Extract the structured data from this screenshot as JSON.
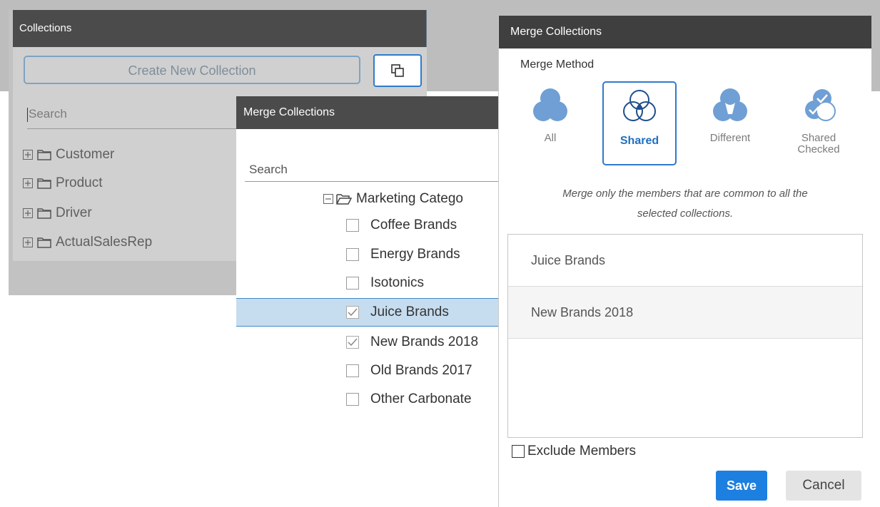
{
  "collections_panel": {
    "title": "Collections",
    "create_button_label": "Create New Collection",
    "search_placeholder": "Search",
    "tree_items": [
      {
        "label": "Customer"
      },
      {
        "label": "Product"
      },
      {
        "label": "Driver"
      },
      {
        "label": "ActualSalesRep"
      }
    ],
    "icons": {
      "expand": "plus-square-icon",
      "folder": "folder-icon",
      "collapse_panel": "collapse-panel-icon"
    }
  },
  "merge_dialog_list": {
    "title": "Merge Collections",
    "search_placeholder": "Search",
    "category_label": "Marketing Catego",
    "items": [
      {
        "label": "Coffee Brands",
        "checked": false,
        "selected": false
      },
      {
        "label": "Energy Brands",
        "checked": false,
        "selected": false
      },
      {
        "label": "Isotonics",
        "checked": false,
        "selected": false
      },
      {
        "label": "Juice Brands",
        "checked": true,
        "selected": true
      },
      {
        "label": "New Brands 2018",
        "checked": true,
        "selected": false
      },
      {
        "label": "Old Brands 2017",
        "checked": false,
        "selected": false
      },
      {
        "label": "Other Carbonate",
        "checked": false,
        "selected": false
      }
    ]
  },
  "merge_dialog_method": {
    "title": "Merge Collections",
    "method_label": "Merge Method",
    "options": [
      {
        "label": "All",
        "icon": "venn-all-icon",
        "selected": false
      },
      {
        "label": "Shared",
        "icon": "venn-shared-icon",
        "selected": true
      },
      {
        "label": "Different",
        "icon": "venn-different-icon",
        "selected": false
      },
      {
        "label": "Shared Checked",
        "label_line1": "Shared",
        "label_line2": "Checked",
        "icon": "venn-shared-checked-icon",
        "selected": false
      }
    ],
    "description_line1": "Merge only the members that are common to all the",
    "description_line2": "selected collections.",
    "selected_members": [
      "Juice Brands",
      "New Brands 2018"
    ],
    "exclude_members_label": "Exclude Members",
    "exclude_members_checked": false,
    "save_label": "Save",
    "cancel_label": "Cancel",
    "colors": {
      "accent": "#1d7fe0",
      "venn_fill": "#6f9fd4",
      "header": "#3f3f3f"
    }
  }
}
